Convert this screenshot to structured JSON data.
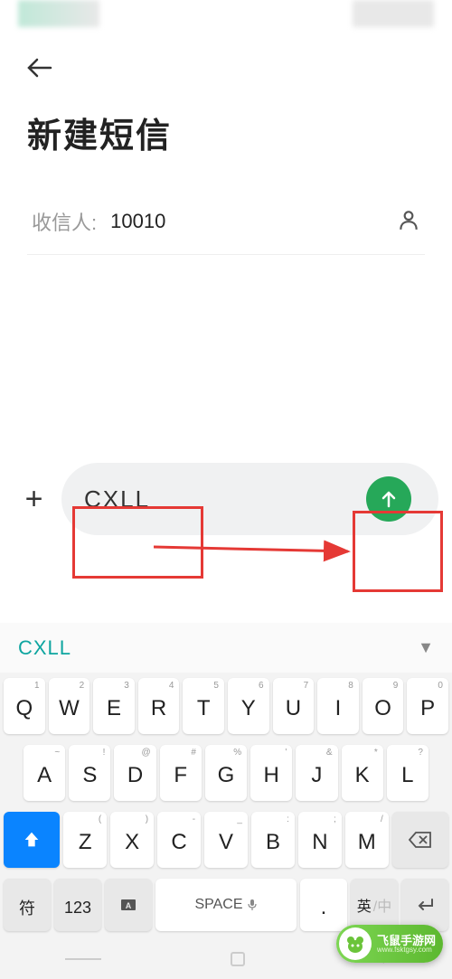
{
  "header": {
    "title": "新建短信"
  },
  "recipient": {
    "label": "收信人:",
    "value": "10010"
  },
  "compose": {
    "message_text": "CXLL"
  },
  "keyboard": {
    "candidate": "CXLL",
    "row1": [
      {
        "super": "1",
        "main": "Q"
      },
      {
        "super": "2",
        "main": "W"
      },
      {
        "super": "3",
        "main": "E"
      },
      {
        "super": "4",
        "main": "R"
      },
      {
        "super": "5",
        "main": "T"
      },
      {
        "super": "6",
        "main": "Y"
      },
      {
        "super": "7",
        "main": "U"
      },
      {
        "super": "8",
        "main": "I"
      },
      {
        "super": "9",
        "main": "O"
      },
      {
        "super": "0",
        "main": "P"
      }
    ],
    "row2": [
      {
        "super": "~",
        "main": "A"
      },
      {
        "super": "!",
        "main": "S"
      },
      {
        "super": "@",
        "main": "D"
      },
      {
        "super": "#",
        "main": "F"
      },
      {
        "super": "%",
        "main": "G"
      },
      {
        "super": "'",
        "main": "H"
      },
      {
        "super": "&",
        "main": "J"
      },
      {
        "super": "*",
        "main": "K"
      },
      {
        "super": "?",
        "main": "L"
      }
    ],
    "row3": [
      {
        "super": "(",
        "main": "Z"
      },
      {
        "super": ")",
        "main": "X"
      },
      {
        "super": "-",
        "main": "C"
      },
      {
        "super": "_",
        "main": "V"
      },
      {
        "super": ":",
        "main": "B"
      },
      {
        "super": ";",
        "main": "N"
      },
      {
        "super": "/",
        "main": "M"
      }
    ],
    "bottom": {
      "symbol": "符",
      "num": "123",
      "space": "SPACE",
      "dot": ".",
      "lang_active": "英",
      "lang_inactive": "/中",
      "enter": "↵"
    }
  },
  "watermark": {
    "title": "飞鼠手游网",
    "url": "www.fsktgsy.com"
  }
}
